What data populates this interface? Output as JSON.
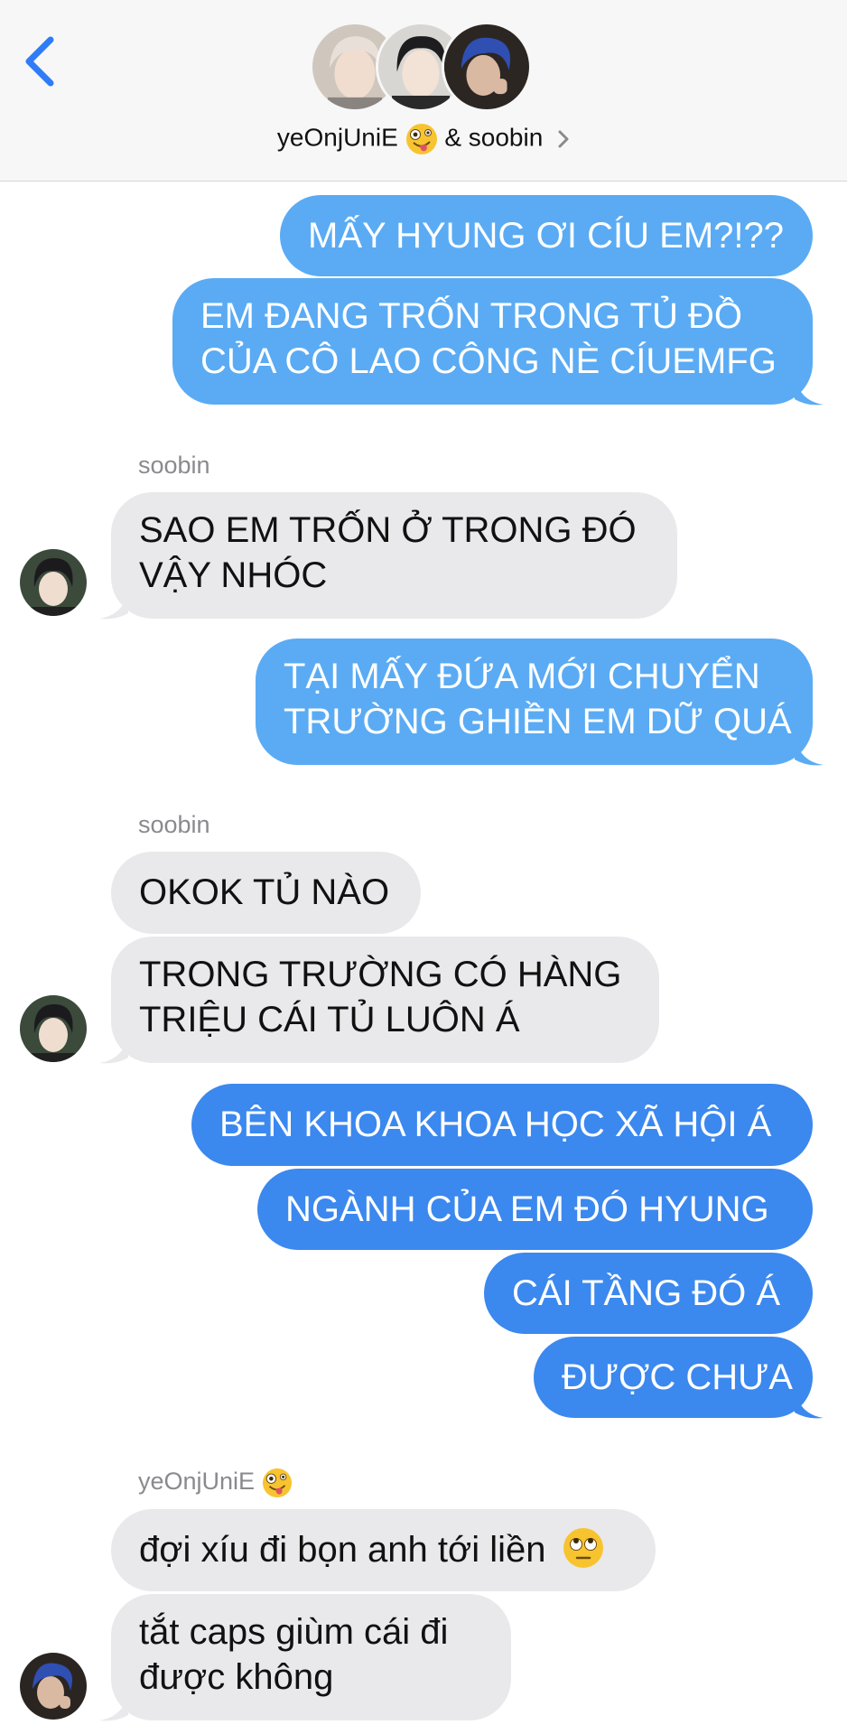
{
  "header": {
    "back_icon": "chevron-left-icon",
    "title_name1": "yeOnjUniE",
    "title_emoji": "zany-face-emoji",
    "title_rest": "& soobin",
    "chevron_icon": "chevron-right-icon"
  },
  "colors": {
    "header_bg": "#f7f7f7",
    "sent_light": "#5aabf4",
    "sent_dark": "#3b88ef",
    "received": "#e9e9eb",
    "accent": "#2f7cf6"
  },
  "messages": {
    "m1": {
      "line1": "MẤY HYUNG ƠI CÍU EM?!??"
    },
    "m2": {
      "line1": "EM ĐANG TRỐN TRONG TỦ ĐỒ",
      "line2": "CỦA CÔ LAO CÔNG NÈ CÍUEMFG"
    },
    "sender1": "soobin",
    "m3": {
      "line1": "SAO EM TRỐN Ở TRONG ĐÓ",
      "line2": "VẬY NHÓC"
    },
    "m4": {
      "line1": "TẠI MẤY ĐỨA MỚI CHUYỂN",
      "line2": "TRƯỜNG GHIỀN EM DỮ QUÁ"
    },
    "sender2": "soobin",
    "m5": {
      "line1": "OKOK TỦ NÀO"
    },
    "m6": {
      "line1": "TRONG TRƯỜNG CÓ HÀNG",
      "line2": "TRIỆU CÁI TỦ LUÔN Á"
    },
    "m7": {
      "line1": "BÊN KHOA KHOA HỌC XÃ HỘI Á"
    },
    "m8": {
      "line1": "NGÀNH CỦA EM ĐÓ HYUNG"
    },
    "m9": {
      "line1": "CÁI TẦNG ĐÓ Á"
    },
    "m10": {
      "line1": "ĐƯỢC CHƯA"
    },
    "sender3": "yeOnjUniE",
    "m11": {
      "line1": "đợi xíu đi bọn anh tới liền",
      "emoji": "eye-roll-emoji"
    },
    "m12": {
      "line1": "tắt caps giùm cái đi",
      "line2": "được không"
    }
  }
}
